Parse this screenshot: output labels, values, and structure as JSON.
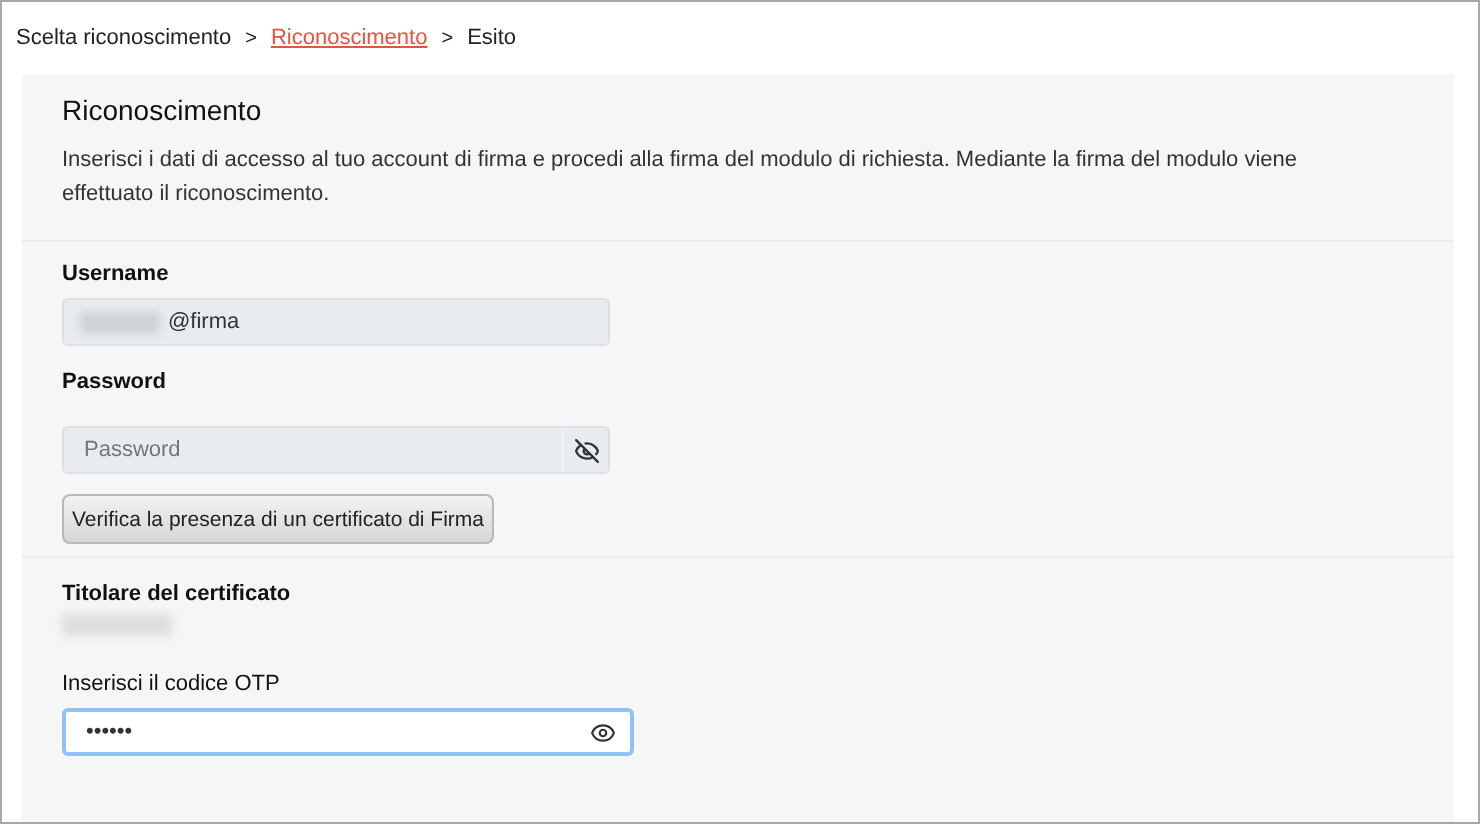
{
  "breadcrumb": [
    {
      "kind": "step",
      "label": "Scelta riconoscimento",
      "selected": false
    },
    {
      "kind": "separator",
      "label": ">"
    },
    {
      "kind": "step",
      "label": "Riconoscimento",
      "selected": true
    },
    {
      "kind": "separator",
      "label": ">"
    },
    {
      "kind": "step",
      "label": "Esito",
      "selected": false
    }
  ],
  "card": {
    "title": "Riconoscimento",
    "description": "Inserisci i dati di accesso al tuo account di firma e procedi alla firma del modulo di richiesta. Mediante la firma del modulo viene effettuato il riconoscimento."
  },
  "username": {
    "label": "Username",
    "value": "@firma",
    "redacted": true
  },
  "password": {
    "label": "Password",
    "placeholder": "Password",
    "icon_crossed": true
  },
  "verify_button": {
    "label": "Verifica la presenza di un certificato di Firma"
  },
  "holder": {
    "label": "Titolare del certificato",
    "redacted": true
  },
  "otp": {
    "label": "Inserisci il codice OTP",
    "value": "••••••",
    "focused": true,
    "icon_crossed": false
  }
}
